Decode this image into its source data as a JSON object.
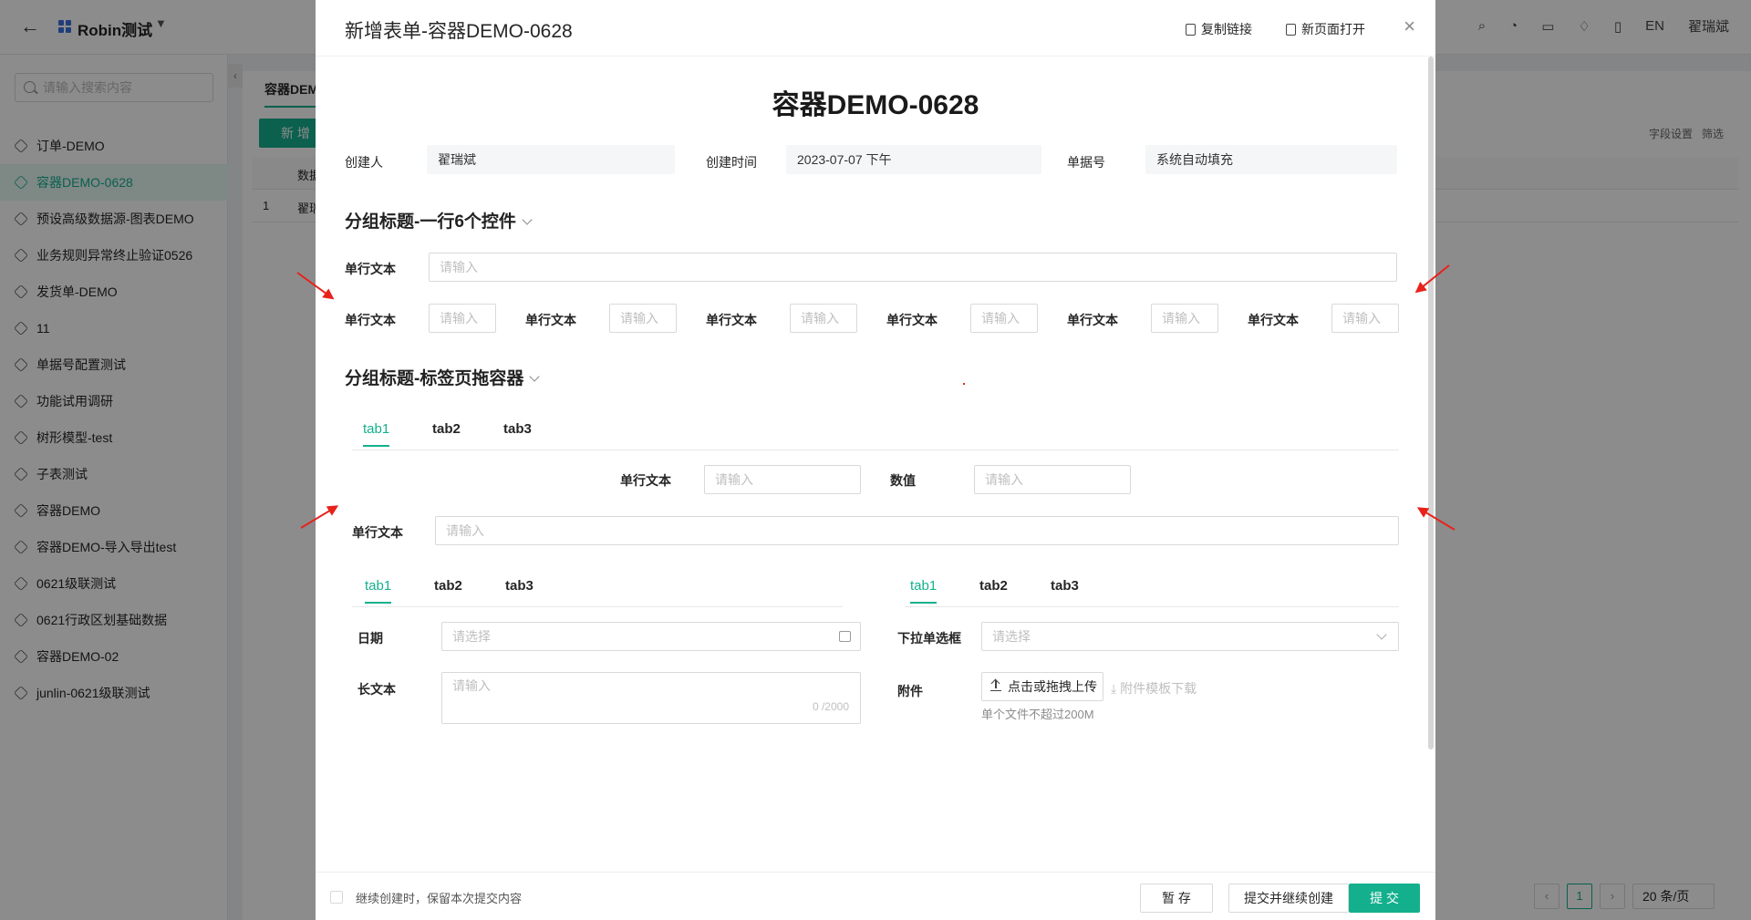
{
  "app": {
    "name": "Robin测试",
    "lang": "EN",
    "user": "翟瑞斌"
  },
  "sidebar": {
    "search_placeholder": "请输入搜索内容",
    "items": [
      {
        "label": "订单-DEMO",
        "active": false
      },
      {
        "label": "容器DEMO-0628",
        "active": true
      },
      {
        "label": "预设高级数据源-图表DEMO",
        "active": false
      },
      {
        "label": "业务规则异常终止验证0526",
        "active": false
      },
      {
        "label": "发货单-DEMO",
        "active": false
      },
      {
        "label": "11",
        "active": false
      },
      {
        "label": "单据号配置测试",
        "active": false
      },
      {
        "label": "功能试用调研",
        "active": false
      },
      {
        "label": "树形模型-test",
        "active": false
      },
      {
        "label": "子表测试",
        "active": false
      },
      {
        "label": "容器DEMO",
        "active": false
      },
      {
        "label": "容器DEMO-导入导出test",
        "active": false
      },
      {
        "label": "0621级联测试",
        "active": false
      },
      {
        "label": "0621行政区划基础数据",
        "active": false
      },
      {
        "label": "容器DEMO-02",
        "active": false
      },
      {
        "label": "junlin-0621级联测试",
        "active": false
      }
    ]
  },
  "background": {
    "tab": "容器DEM",
    "new_button": "新 增",
    "col_head": "数据",
    "row_index": "1",
    "row_cell": "翟瑞",
    "field_settings": "字段设置",
    "filter": "筛选",
    "page_current": "1",
    "page_size": "20 条/页"
  },
  "modal": {
    "title": "新增表单-容器DEMO-0628",
    "copy_link": "复制链接",
    "open_new_page": "新页面打开",
    "form_title": "容器DEMO-0628",
    "meta": {
      "creator_label": "创建人",
      "creator_value": "翟瑞斌",
      "created_time_label": "创建时间",
      "created_time_value": "2023-07-07 下午",
      "doc_no_label": "单据号",
      "doc_no_value": "系统自动填充"
    },
    "section1": {
      "title": "分组标题-一行6个控件",
      "full_label": "单行文本",
      "full_placeholder": "请输入",
      "six_label": "单行文本",
      "six_placeholder": "请输入"
    },
    "section2": {
      "title": "分组标题-标签页拖容器",
      "tabs": [
        "tab1",
        "tab2",
        "tab3"
      ],
      "text_label": "单行文本",
      "number_label": "数值",
      "placeholder": "请输入",
      "wide_label": "单行文本",
      "left_tabs": [
        "tab1",
        "tab2",
        "tab3"
      ],
      "right_tabs": [
        "tab1",
        "tab2",
        "tab3"
      ],
      "date_label": "日期",
      "date_placeholder": "请选择",
      "longtext_label": "长文本",
      "longtext_placeholder": "请输入",
      "longtext_counter": "0 /2000",
      "dropdown_label": "下拉单选框",
      "dropdown_placeholder": "请选择",
      "attachment_label": "附件",
      "upload_button": "点击或拖拽上传",
      "template_download": "附件模板下载",
      "upload_hint": "单个文件不超过200M"
    },
    "footer": {
      "keep_label": "继续创建时，保留本次提交内容",
      "save_draft": "暂 存",
      "submit_continue": "提交并继续创建",
      "submit": "提 交"
    }
  },
  "colors": {
    "accent": "#14b08e",
    "annotation_arrow": "#e8221b"
  }
}
